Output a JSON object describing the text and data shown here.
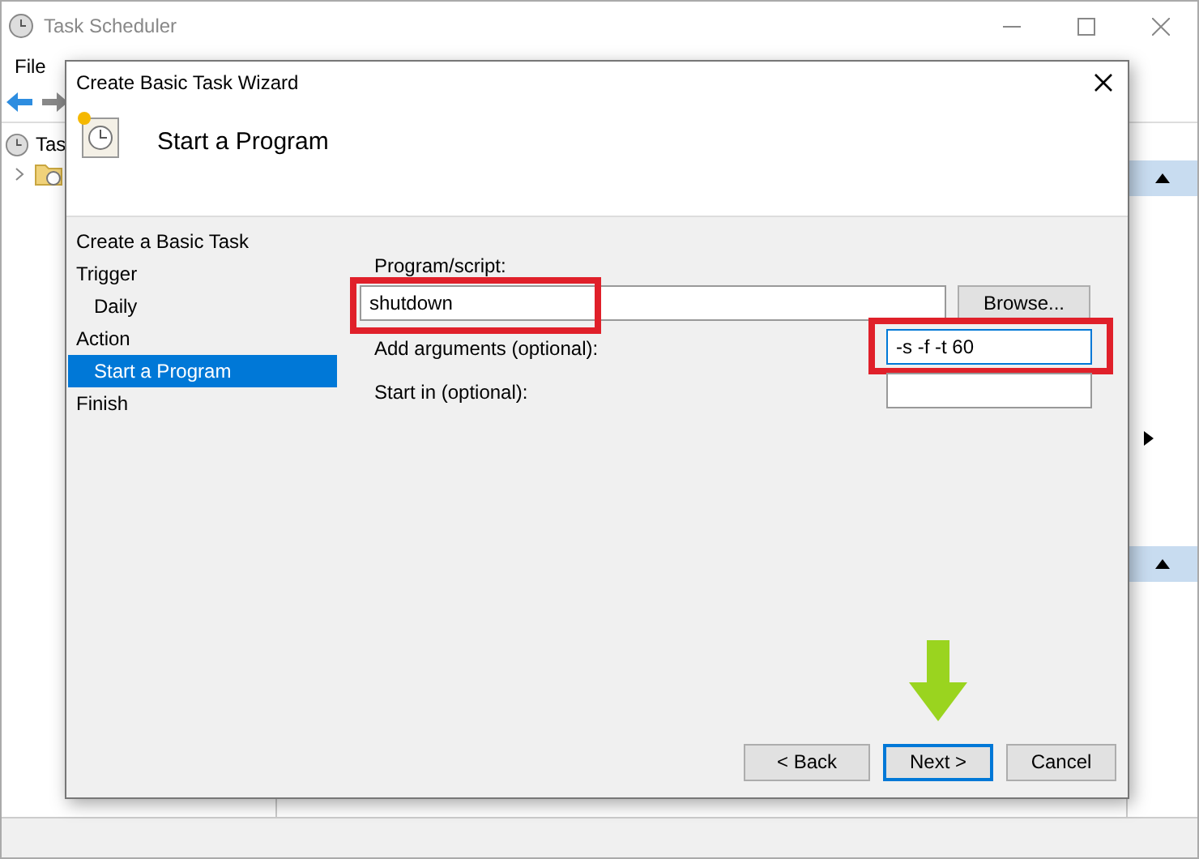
{
  "app_window": {
    "title": "Task Scheduler",
    "menu": [
      "File"
    ],
    "tree": [
      {
        "label": "Tas",
        "children": [
          {
            "expanded": false
          }
        ]
      }
    ]
  },
  "dialog": {
    "title": "Create Basic Task Wizard",
    "heading": "Start a Program",
    "steps": [
      {
        "label": "Create a Basic Task",
        "selected": false
      },
      {
        "label": "Trigger",
        "selected": false,
        "children": [
          {
            "label": "Daily",
            "selected": false
          }
        ]
      },
      {
        "label": "Action",
        "selected": false,
        "children": [
          {
            "label": "Start a Program",
            "selected": true
          }
        ]
      },
      {
        "label": "Finish",
        "selected": false
      }
    ],
    "fields": [
      {
        "kind": "wide",
        "label": "Program/script:",
        "value": "shutdown",
        "focused": false,
        "browse": "Browse..."
      },
      {
        "kind": "short",
        "label": "Add arguments (optional):",
        "value": "-s -f -t 60",
        "focused": true
      },
      {
        "kind": "short",
        "label": "Start in (optional):",
        "focused": false
      }
    ],
    "buttons": [
      {
        "label": "< Back",
        "default": false
      },
      {
        "label": "Next >",
        "default": true
      },
      {
        "label": "Cancel",
        "default": false
      }
    ]
  }
}
